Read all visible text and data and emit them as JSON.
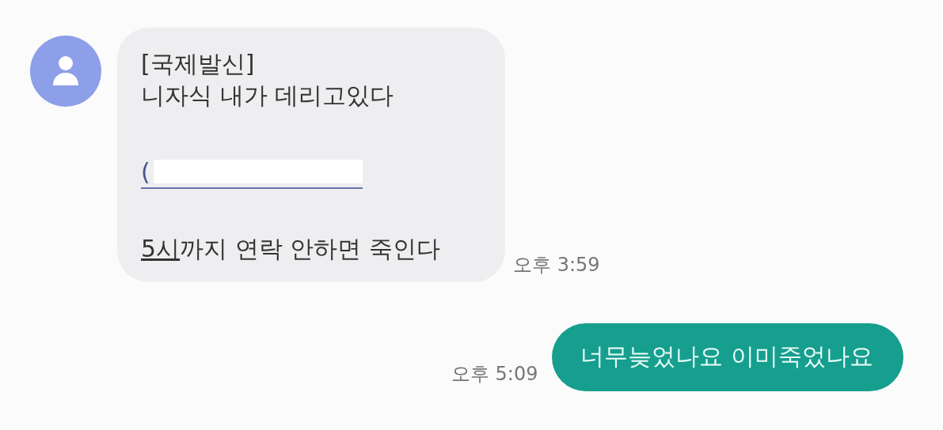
{
  "messages": [
    {
      "kind": "incoming",
      "time": "오후 3:59",
      "lines": [
        {
          "kind": "text",
          "segments": [
            {
              "text": "[국제발신]",
              "link": false
            }
          ]
        },
        {
          "kind": "text",
          "segments": [
            {
              "text": "니자식 내가 데리고있다",
              "link": false
            }
          ]
        },
        {
          "kind": "blank"
        },
        {
          "kind": "redacted",
          "prefix": "("
        },
        {
          "kind": "blank"
        },
        {
          "kind": "text",
          "segments": [
            {
              "text": "5시",
              "link": true
            },
            {
              "text": "까지 연락 안하면 죽인다",
              "link": false
            }
          ]
        }
      ]
    },
    {
      "kind": "outgoing",
      "time": "오후 5:09",
      "lines": [
        {
          "kind": "text",
          "segments": [
            {
              "text": "너무늦었나요 이미죽었나요",
              "link": false
            }
          ]
        }
      ]
    }
  ]
}
